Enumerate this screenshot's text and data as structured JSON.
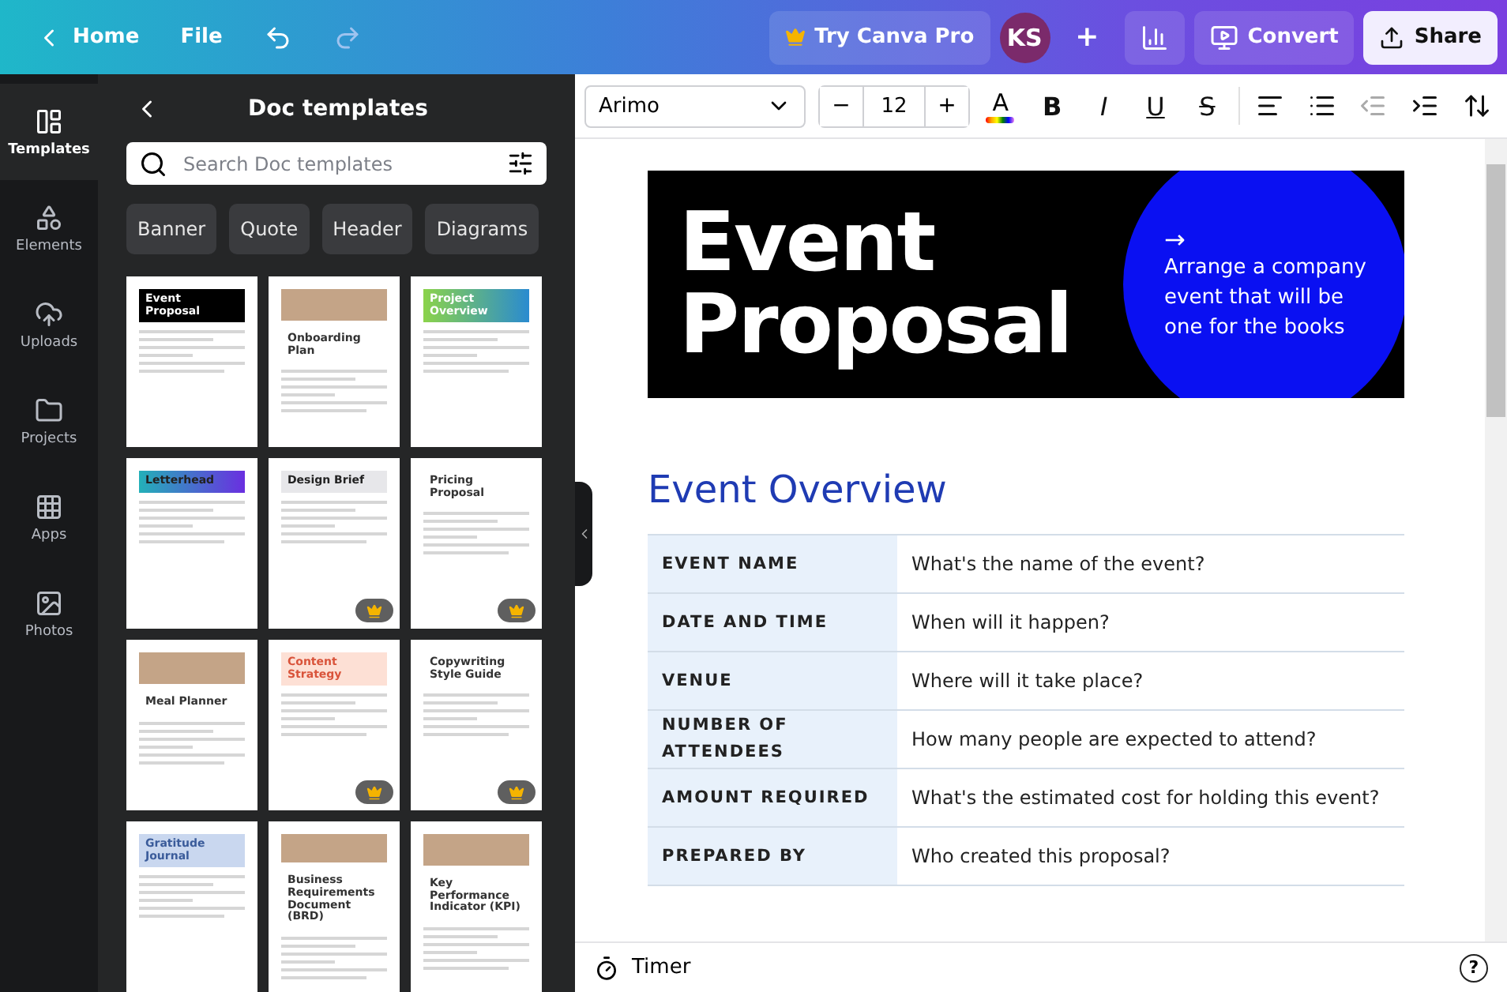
{
  "topbar": {
    "home": "Home",
    "file": "File",
    "pro": "Try Canva Pro",
    "avatar": "KS",
    "plus": "+",
    "convert": "Convert",
    "share": "Share"
  },
  "rail": [
    {
      "label": "Templates",
      "selected": true
    },
    {
      "label": "Elements",
      "selected": false
    },
    {
      "label": "Uploads",
      "selected": false
    },
    {
      "label": "Projects",
      "selected": false
    },
    {
      "label": "Apps",
      "selected": false
    },
    {
      "label": "Photos",
      "selected": false
    }
  ],
  "panel": {
    "title": "Doc templates",
    "search": {
      "placeholder": "Search Doc templates"
    },
    "chips": [
      "Banner",
      "Quote",
      "Header",
      "Diagrams"
    ],
    "templates": [
      {
        "title": "Event Proposal",
        "premium": false
      },
      {
        "title": "Onboarding Plan",
        "premium": false
      },
      {
        "title": "Project Overview",
        "premium": false
      },
      {
        "title": "Letterhead",
        "premium": false
      },
      {
        "title": "Design Brief",
        "premium": true
      },
      {
        "title": "Pricing Proposal",
        "premium": true
      },
      {
        "title": "Meal Planner",
        "premium": false
      },
      {
        "title": "Content Strategy",
        "premium": true
      },
      {
        "title": "Copywriting Style Guide",
        "premium": true
      },
      {
        "title": "Gratitude Journal",
        "premium": false
      },
      {
        "title": "Business Requirements Document (BRD)",
        "premium": false
      },
      {
        "title": "Key Performance Indicator (KPI)",
        "premium": false
      }
    ]
  },
  "toolbar": {
    "font": "Arimo",
    "minus": "−",
    "size": "12",
    "plus": "+",
    "text_color_glyph": "A",
    "bold": "B",
    "italic": "I",
    "underline": "U",
    "strike": "S"
  },
  "document": {
    "banner": {
      "title_lines": [
        "Event",
        "Proposal"
      ],
      "arrow": "→",
      "tagline": "Arrange a company event that will be one for the books"
    },
    "heading": "Event Overview",
    "rows": [
      {
        "label": "EVENT NAME",
        "value": "What's the name of the event?"
      },
      {
        "label": "DATE AND TIME",
        "value": "When will it happen?"
      },
      {
        "label": "VENUE",
        "value": "Where will it take place?"
      },
      {
        "label": "NUMBER OF ATTENDEES",
        "value": "How many people are expected to attend?"
      },
      {
        "label": "AMOUNT REQUIRED",
        "value": "What's the estimated cost for holding this event?"
      },
      {
        "label": "PREPARED BY",
        "value": "Who created this proposal?"
      }
    ]
  },
  "bottom": {
    "timer": "Timer",
    "help": "?"
  }
}
